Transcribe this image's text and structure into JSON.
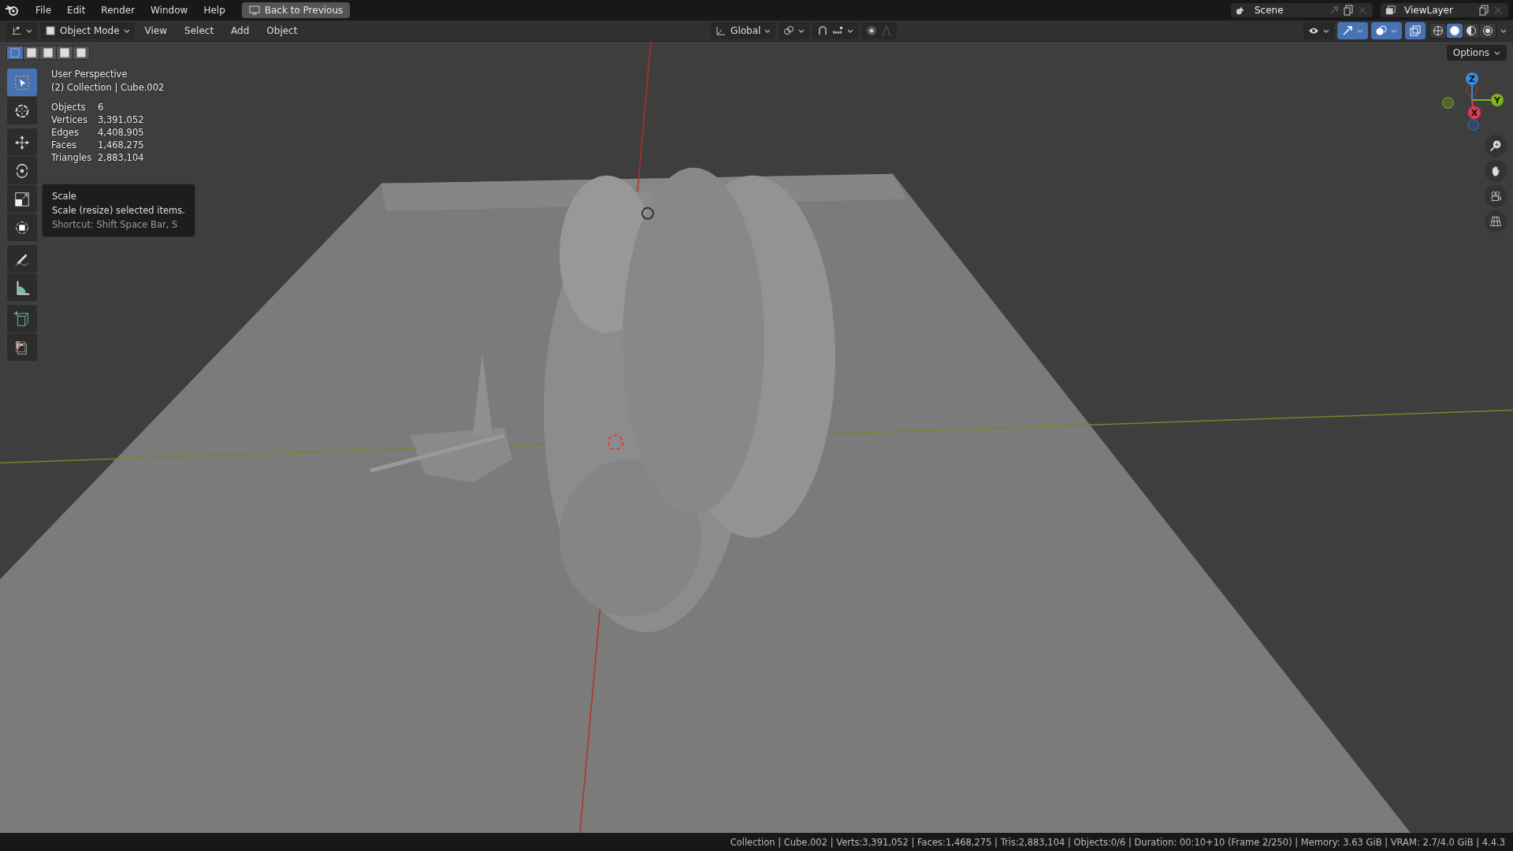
{
  "topbar": {
    "menus": [
      "File",
      "Edit",
      "Render",
      "Window",
      "Help"
    ],
    "back_button": "Back to Previous",
    "scene": "Scene",
    "view_layer": "ViewLayer"
  },
  "header": {
    "mode": "Object Mode",
    "menus": [
      "View",
      "Select",
      "Add",
      "Object"
    ],
    "orientation": "Global",
    "select_modes": [
      {
        "selected": true
      },
      {
        "selected": false
      },
      {
        "selected": false
      },
      {
        "selected": false
      },
      {
        "selected": false
      }
    ],
    "toggles": [
      {
        "kind": "visibility",
        "on": false
      },
      {
        "kind": "gizmo",
        "on": true
      },
      {
        "kind": "overlay",
        "on": true
      },
      {
        "kind": "xray",
        "on": true
      }
    ],
    "shading": [
      {
        "selected": false
      },
      {
        "selected": true
      },
      {
        "selected": false
      },
      {
        "selected": false
      }
    ],
    "options_button": "Options"
  },
  "tool_groups": [
    [
      {
        "kind": "select",
        "selected": true
      },
      {
        "kind": "cursor",
        "selected": false
      }
    ],
    [
      {
        "kind": "move",
        "selected": false
      },
      {
        "kind": "rotate",
        "selected": false
      },
      {
        "kind": "scale",
        "selected": false
      },
      {
        "kind": "transform",
        "selected": false
      }
    ],
    [
      {
        "kind": "annotate",
        "selected": false
      },
      {
        "kind": "measure",
        "selected": false
      }
    ],
    [
      {
        "kind": "add-cube",
        "selected": false
      },
      {
        "kind": "cut",
        "selected": false
      }
    ]
  ],
  "overlay_text": {
    "view": "User Perspective",
    "context": "(2) Collection | Cube.002",
    "stats": [
      {
        "label": "Objects",
        "value": "6"
      },
      {
        "label": "Vertices",
        "value": "3,391,052"
      },
      {
        "label": "Edges",
        "value": "4,408,905"
      },
      {
        "label": "Faces",
        "value": "1,468,275"
      },
      {
        "label": "Triangles",
        "value": "2,883,104"
      }
    ]
  },
  "tooltip": {
    "title": "Scale",
    "description": "Scale (resize) selected items.",
    "shortcut": "Shortcut: Shift Space Bar, S"
  },
  "gizmo": {
    "z": "Z",
    "y": "Y",
    "x": "X"
  },
  "status_bar": "Collection | Cube.002 | Verts:3,391,052 | Faces:1,468,275 | Tris:2,883,104 | Objects:0/6 | Duration: 00:10+10 (Frame 2/250) | Memory: 3.63 GiB | VRAM: 2.7/4.0 GiB | 4.4.3"
}
